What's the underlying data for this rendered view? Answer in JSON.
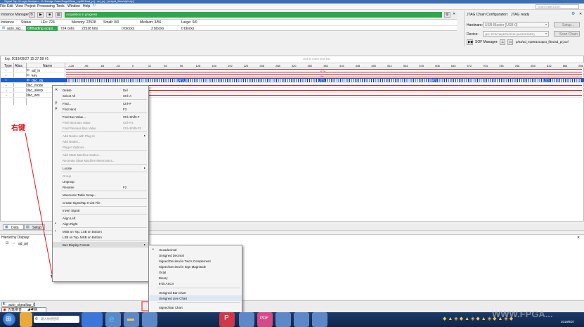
{
  "title_bar": {
    "text": "Signal Tap II Logic Analyzer - D:/Design Case/Page53/ad_mpl801/ad_prj - ad_prj - [output_files/stp1.stp]"
  },
  "menu_bar": [
    "File",
    "Edit",
    "View",
    "Project",
    "Processing",
    "Tools",
    "Window",
    "Help"
  ],
  "search_placeholder": "Search altera.com",
  "instance_manager": {
    "label": "Instance Manager:",
    "status": "Acquisition in progress",
    "columns": [
      "Instance",
      "Status",
      "LEs: 724",
      "Memory: 22528",
      "Small: 0/0",
      "Medium: 3/56",
      "Large: 0/0"
    ],
    "row": {
      "instance": "auto_sig...",
      "status": "Offloading acqui...",
      "les": "724 cells",
      "memory": "22528 bits",
      "small": "0 blocks",
      "medium": "3 blocks",
      "large": "0 blocks"
    }
  },
  "jtag": {
    "label": "JTAG Chain Configuration:",
    "status": "JTAG ready",
    "hardware_label": "Hardware:",
    "hardware_value": "USB-Blaster [USB-0]",
    "setup": "Setup...",
    "device_label": "Device:",
    "device_value": "@1: EP3C16(/EP4CE15 (0x020F30DD)",
    "scan_chain": "Scan Chain",
    "sof_label": "SOF Manager:",
    "sof_path": "p/53/ad_mp801/output_files/ad_prj.sof"
  },
  "waveform": {
    "log_label": "log: 2019/09/27 15:37:58  #1",
    "click_hint": "click to insert time bar",
    "headers": {
      "type": "Type",
      "alias": "Alias",
      "name": "Name"
    },
    "ticks": [
      "-128",
      "-96",
      "-64",
      "-32",
      "0",
      "32",
      "64",
      "96",
      "128",
      "160",
      "192",
      "224",
      "256",
      "288",
      "320",
      "352",
      "384",
      "416",
      "448",
      "480",
      "512",
      "544",
      "576",
      "608",
      "640",
      "672",
      "704",
      "736",
      "768",
      "800",
      "832",
      "864",
      "896"
    ],
    "signals": [
      {
        "name": "ad_in",
        "value": "E7h"
      },
      {
        "name": "key",
        "value": "0h"
      },
      {
        "name": "dac_da",
        "value": ""
      },
      {
        "name": "dac_mode",
        "value": ""
      },
      {
        "name": "dac_sleep",
        "value": ""
      },
      {
        "name": "dac_wrs",
        "value": ""
      }
    ],
    "bus_markers": [
      "8Fh",
      "7Fh",
      "8Fh",
      "7Fh"
    ]
  },
  "tabs": {
    "data": "Data",
    "setup": "Setup"
  },
  "hierarchy": {
    "label": "Hierarchy Display:",
    "item": "ad_prj"
  },
  "annotation": {
    "text": "右键",
    "color": "#e8141c"
  },
  "context_menu": {
    "items": [
      {
        "label": "Delete",
        "shortcut": "Del",
        "icon": "✕",
        "disabled": false
      },
      {
        "label": "Select All",
        "shortcut": "Ctrl+A",
        "icon": "",
        "disabled": false
      },
      {
        "sep": true
      },
      {
        "label": "Find...",
        "shortcut": "Ctrl+F",
        "icon": "⚲",
        "disabled": false
      },
      {
        "label": "Find Next",
        "shortcut": "F3",
        "icon": "⚲",
        "disabled": false
      },
      {
        "sep": true
      },
      {
        "label": "Find Bus Value...",
        "shortcut": "Ctrl+Shift+F",
        "icon": "",
        "disabled": false
      },
      {
        "label": "Find Next Bus Value",
        "shortcut": "Ctrl+F3",
        "icon": "",
        "disabled": true
      },
      {
        "label": "Find Previous Bus Value",
        "shortcut": "Ctrl+Shift+F3",
        "icon": "",
        "disabled": true
      },
      {
        "sep": true
      },
      {
        "label": "Add Nodes with Plug-In",
        "shortcut": "",
        "icon": "",
        "disabled": true,
        "submenu": true
      },
      {
        "label": "Add Nodes...",
        "shortcut": "",
        "icon": "",
        "disabled": true
      },
      {
        "label": "Plug-In Options...",
        "shortcut": "",
        "icon": "",
        "disabled": true
      },
      {
        "sep": true
      },
      {
        "label": "Add State Machine Nodes...",
        "shortcut": "",
        "icon": "",
        "disabled": true
      },
      {
        "label": "Recreate State Machine Mnemonics...",
        "shortcut": "",
        "icon": "",
        "disabled": true
      },
      {
        "sep": true
      },
      {
        "label": "Locate",
        "shortcut": "",
        "icon": "",
        "disabled": false,
        "submenu": true
      },
      {
        "sep": true
      },
      {
        "label": "Group",
        "shortcut": "",
        "icon": "",
        "disabled": true
      },
      {
        "label": "Ungroup",
        "shortcut": "",
        "icon": "",
        "disabled": false
      },
      {
        "label": "Rename",
        "shortcut": "F2",
        "icon": "",
        "disabled": false
      },
      {
        "sep": true
      },
      {
        "label": "Mnemonic Table Setup...",
        "shortcut": "",
        "icon": "",
        "disabled": false
      },
      {
        "sep": true
      },
      {
        "label": "Create SignalTap II List File",
        "shortcut": "",
        "icon": "",
        "disabled": false
      },
      {
        "sep": true
      },
      {
        "label": "Invert Signal",
        "shortcut": "",
        "icon": "",
        "disabled": false
      },
      {
        "sep": true
      },
      {
        "label": "Align Left",
        "shortcut": "",
        "icon": "",
        "disabled": false
      },
      {
        "label": "Align Right",
        "shortcut": "",
        "icon": "•",
        "disabled": false
      },
      {
        "sep": true
      },
      {
        "label": "MSB on Top, LSB on Bottom",
        "shortcut": "",
        "icon": "•",
        "disabled": false
      },
      {
        "label": "LSB on Top, MSB on Bottom",
        "shortcut": "",
        "icon": "",
        "disabled": false
      },
      {
        "sep": true
      },
      {
        "label": "Bus Display Format",
        "shortcut": "",
        "icon": "",
        "disabled": false,
        "submenu": true,
        "active": true
      }
    ]
  },
  "sub_menu": {
    "items": [
      {
        "label": "Hexadecimal",
        "bullet": true
      },
      {
        "label": "Unsigned Decimal"
      },
      {
        "label": "Signed Decimal in Two's Complement"
      },
      {
        "label": "Signed Decimal in Sign Magnitude"
      },
      {
        "label": "Octal"
      },
      {
        "label": "Binary"
      },
      {
        "label": "8-bit ASCII"
      },
      {
        "sep": true
      },
      {
        "label": "Unsigned Bar Chart"
      },
      {
        "label": "Unsigned Line Chart",
        "highlighted": true
      },
      {
        "sep": true
      },
      {
        "label": "Signed Bar Chart"
      },
      {
        "label": "Signed Line Chart"
      }
    ]
  },
  "bottom": {
    "tab": "auto_signaltap_0",
    "ime": "五笔拼音"
  },
  "taskbar": {
    "search_placeholder": "输入你想搜的",
    "date": "2019/9/27",
    "watermark": "WWW.FPGA..."
  },
  "colors": {
    "acq_green": "#2ea84a",
    "selected_row": "#1e5fd0",
    "red_box": "#e8141c",
    "bus_blue": "#1b3fae"
  }
}
